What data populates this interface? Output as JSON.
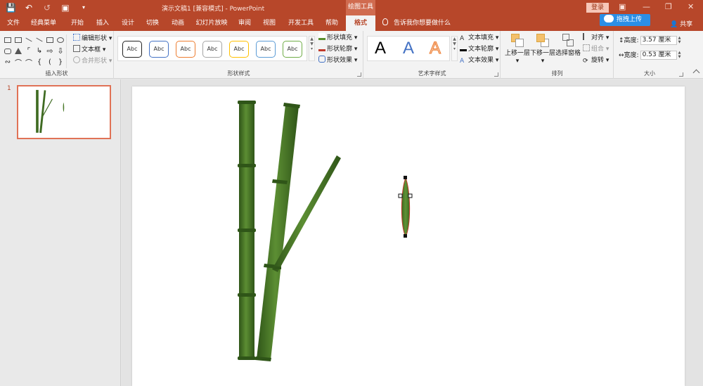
{
  "window": {
    "title": "演示文稿1 [兼容模式] - PowerPoint",
    "contextual_tab": "绘图工具",
    "login": "登录",
    "upload": "拖拽上传",
    "share": "共享"
  },
  "tabs": [
    "文件",
    "经典菜单",
    "开始",
    "插入",
    "设计",
    "切换",
    "动画",
    "幻灯片放映",
    "审阅",
    "视图",
    "开发工具",
    "帮助",
    "格式"
  ],
  "active_tab": "格式",
  "tell_me": "告诉我你想要做什么",
  "ribbon": {
    "insert_shapes": {
      "label": "插入形状",
      "edit_shape": "编辑形状",
      "text_box": "文本框",
      "merge_shapes": "合并形状"
    },
    "shape_styles": {
      "label": "形状样式",
      "preset_text": "Abc",
      "preset_colors": [
        "#222222",
        "#4472c4",
        "#ed7d31",
        "#a5a5a5",
        "#ffc000",
        "#5b9bd5",
        "#70ad47"
      ],
      "fill": "形状填充",
      "outline": "形状轮廓",
      "effects": "形状效果"
    },
    "wordart": {
      "label": "艺术字样式",
      "sample": "A",
      "text_fill": "文本填充",
      "text_outline": "文本轮廓",
      "text_effects": "文本效果"
    },
    "arrange": {
      "label": "排列",
      "bring_forward": "上移一层",
      "send_backward": "下移一层",
      "selection_pane": "选择窗格",
      "align": "对齐",
      "group": "组合",
      "rotate": "旋转"
    },
    "size": {
      "label": "大小",
      "height_label": "高度:",
      "height_value": "3.57 厘米",
      "width_label": "宽度:",
      "width_value": "0.53 厘米"
    }
  },
  "slides": {
    "current_number": "1"
  },
  "colors": {
    "accent": "#b7472a",
    "bamboo_dark": "#2f5518",
    "bamboo_mid": "#4a7a2a",
    "bamboo_light": "#6a9a3c",
    "selection_outline": "#c0392b"
  }
}
